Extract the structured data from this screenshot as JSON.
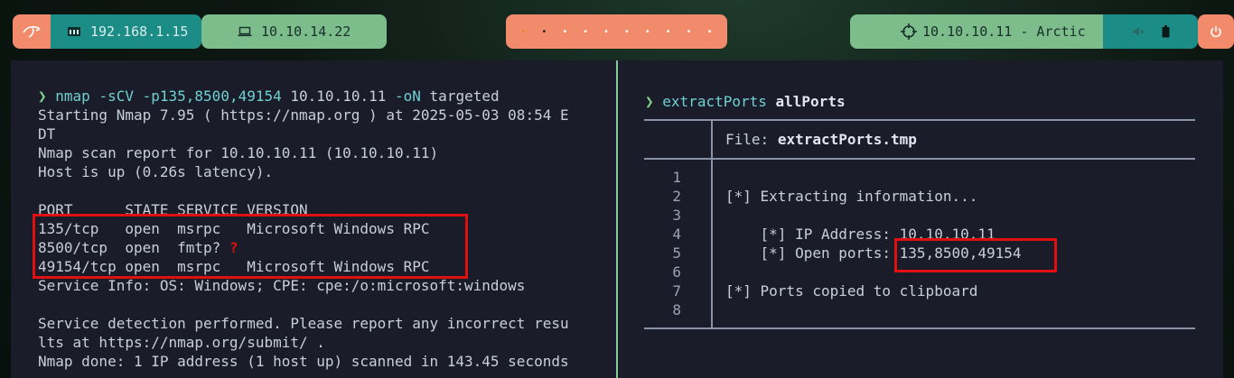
{
  "topbar": {
    "kali_icon": "kali-dragon-icon",
    "local_ip": "192.168.1.15",
    "vpn_ip": "10.10.14.22",
    "target": "10.10.10.11 - Arctic",
    "workspaces": [
      "•",
      "•",
      "•",
      "•",
      "•",
      "•",
      "•",
      "•",
      "•",
      "•"
    ],
    "status_icons": [
      "volume-muted-icon",
      "battery-icon"
    ],
    "power_icon": "power-icon"
  },
  "left_pane": {
    "prompt_symbol": "❯",
    "command": "nmap",
    "args": "-sCV -p135,8500,49154",
    "target": "10.10.10.11",
    "flag": "-oN",
    "outfile": "targeted",
    "output": [
      "Starting Nmap 7.95 ( https://nmap.org ) at 2025-05-03 08:54 E",
      "DT",
      "Nmap scan report for 10.10.10.11 (10.10.10.11)",
      "Host is up (0.26s latency).",
      "",
      "PORT      STATE SERVICE VERSION",
      "135/tcp   open  msrpc   Microsoft Windows RPC",
      "8500/tcp  open  fmtp?",
      "49154/tcp open  msrpc   Microsoft Windows RPC",
      "Service Info: OS: Windows; CPE: cpe:/o:microsoft:windows",
      "",
      "Service detection performed. Please report any incorrect resu",
      "lts at https://nmap.org/submit/ .",
      "Nmap done: 1 IP address (1 host up) scanned in 143.45 seconds"
    ],
    "annotation_mark": "?"
  },
  "right_pane": {
    "prompt_symbol": "❯",
    "command": "extractPorts",
    "argument": "allPorts",
    "file_label": "File:",
    "file_name": "extractPorts.tmp",
    "line_numbers": [
      "1",
      "2",
      "3",
      "4",
      "5",
      "6",
      "7",
      "8"
    ],
    "lines": [
      "",
      "[*] Extracting information...",
      "",
      "    [*] IP Address: 10.10.10.11",
      "    [*] Open ports: ",
      "",
      "[*] Ports copied to clipboard",
      ""
    ],
    "open_ports": "135,8500,49154"
  },
  "colors": {
    "terminal_bg": "#1a1d29",
    "accent_orange": "#f28b6c",
    "accent_teal": "#1c8c86",
    "accent_green": "#7dbd8c",
    "highlight_red": "#e01010"
  }
}
